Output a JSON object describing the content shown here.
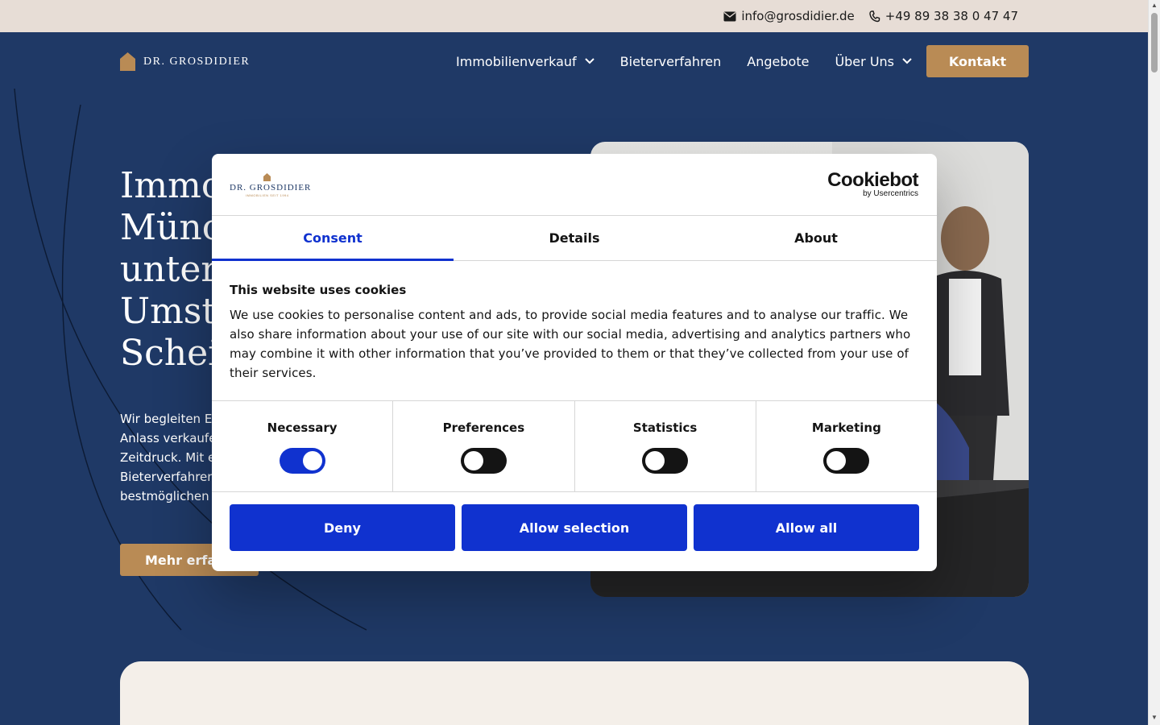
{
  "topbar": {
    "email": "info@grosdidier.de",
    "phone": "+49 89 38 38 0 47 47"
  },
  "header": {
    "logo_text": "DR. GROSDIDIER",
    "nav": [
      {
        "label": "Immobilienverkauf",
        "has_dropdown": true
      },
      {
        "label": "Bieterverfahren",
        "has_dropdown": false
      },
      {
        "label": "Angebote",
        "has_dropdown": false
      },
      {
        "label": "Über Uns",
        "has_dropdown": true
      }
    ],
    "cta_label": "Kontakt"
  },
  "hero": {
    "title_lines": [
      "Immo",
      "Münch",
      "unter b",
      "Umstä",
      "Scheid"
    ],
    "text_lines": [
      "Wir begleiten E",
      "Anlass verkaufe",
      "Zeitdruck. Mit e",
      "Bieterverfahren",
      "bestmöglichen"
    ],
    "button_label": "Mehr erfah"
  },
  "cookie_dialog": {
    "logo_text": "DR. GROSDIDIER",
    "logo_subtext": "IMMOBILIEN SEIT 1994",
    "brand_main": "Cookiebot",
    "brand_sub": "by Usercentrics",
    "tabs": [
      {
        "label": "Consent",
        "active": true
      },
      {
        "label": "Details",
        "active": false
      },
      {
        "label": "About",
        "active": false
      }
    ],
    "title": "This website uses cookies",
    "text": "We use cookies to personalise content and ads, to provide social media features and to analyse our traffic. We also share information about your use of our site with our social media, advertising and analytics partners who may combine it with other information that you’ve provided to them or that they’ve collected from your use of their services.",
    "toggles": [
      {
        "label": "Necessary",
        "on": true
      },
      {
        "label": "Preferences",
        "on": false
      },
      {
        "label": "Statistics",
        "on": false
      },
      {
        "label": "Marketing",
        "on": false
      }
    ],
    "buttons": {
      "deny": "Deny",
      "allow_selection": "Allow selection",
      "allow_all": "Allow all"
    }
  },
  "colors": {
    "navy": "#1f3966",
    "gold": "#b98b55",
    "cookiebot_blue": "#1032cf",
    "topbar": "#e7ddd6"
  }
}
